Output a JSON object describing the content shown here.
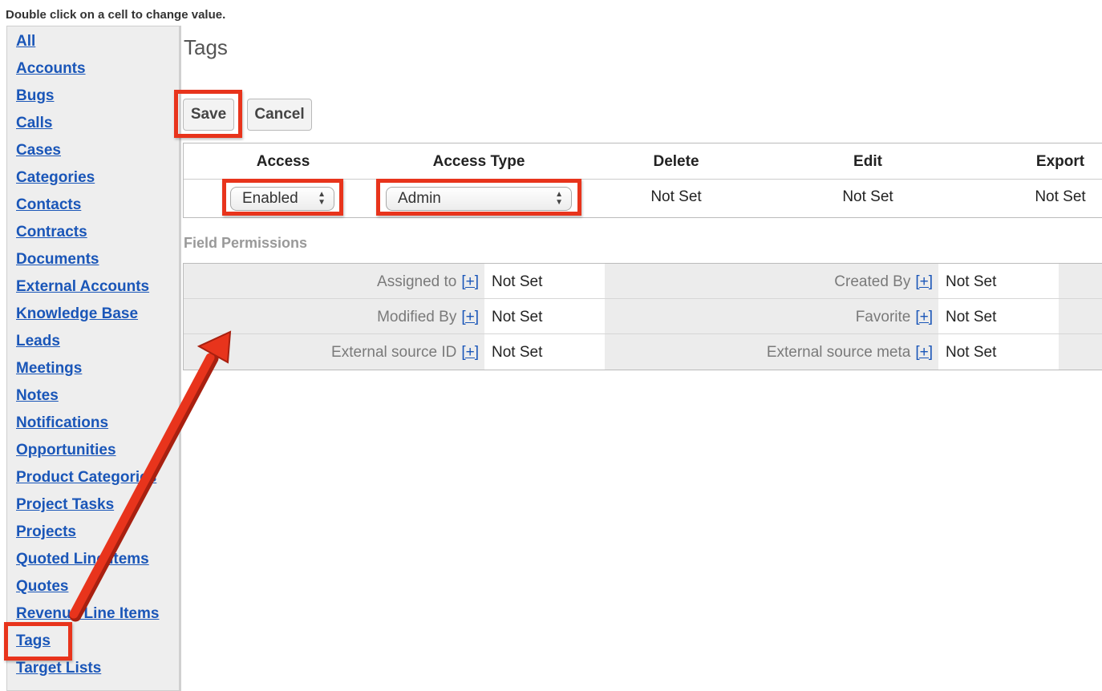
{
  "instruction": "Double click on a cell to change value.",
  "sidebar": {
    "items": [
      {
        "label": "All"
      },
      {
        "label": "Accounts"
      },
      {
        "label": "Bugs"
      },
      {
        "label": "Calls"
      },
      {
        "label": "Cases"
      },
      {
        "label": "Categories"
      },
      {
        "label": "Contacts"
      },
      {
        "label": "Contracts"
      },
      {
        "label": "Documents"
      },
      {
        "label": "External Accounts"
      },
      {
        "label": "Knowledge Base"
      },
      {
        "label": "Leads"
      },
      {
        "label": "Meetings"
      },
      {
        "label": "Notes"
      },
      {
        "label": "Notifications"
      },
      {
        "label": "Opportunities"
      },
      {
        "label": "Product Categories"
      },
      {
        "label": "Project Tasks"
      },
      {
        "label": "Projects"
      },
      {
        "label": "Quoted Line Items"
      },
      {
        "label": "Quotes"
      },
      {
        "label": "Revenue Line Items"
      },
      {
        "label": "Tags"
      },
      {
        "label": "Target Lists"
      }
    ]
  },
  "page": {
    "title": "Tags",
    "save_label": "Save",
    "cancel_label": "Cancel"
  },
  "access_table": {
    "headers": {
      "access": "Access",
      "access_type": "Access Type",
      "delete": "Delete",
      "edit": "Edit",
      "export": "Export"
    },
    "row": {
      "access": "Enabled",
      "access_type": "Admin",
      "delete": "Not Set",
      "edit": "Not Set",
      "export": "Not Set"
    }
  },
  "field_permissions": {
    "title": "Field Permissions",
    "plus_label": "[+]",
    "rows": [
      [
        {
          "label": "Assigned to",
          "value": "Not Set"
        },
        {
          "label": "Created By",
          "value": "Not Set"
        }
      ],
      [
        {
          "label": "Modified By",
          "value": "Not Set"
        },
        {
          "label": "Favorite",
          "value": "Not Set"
        }
      ],
      [
        {
          "label": "External source ID",
          "value": "Not Set"
        },
        {
          "label": "External source meta",
          "value": "Not Set"
        }
      ]
    ]
  },
  "colors": {
    "highlight": "#e8341c",
    "link": "#1a56b8"
  }
}
